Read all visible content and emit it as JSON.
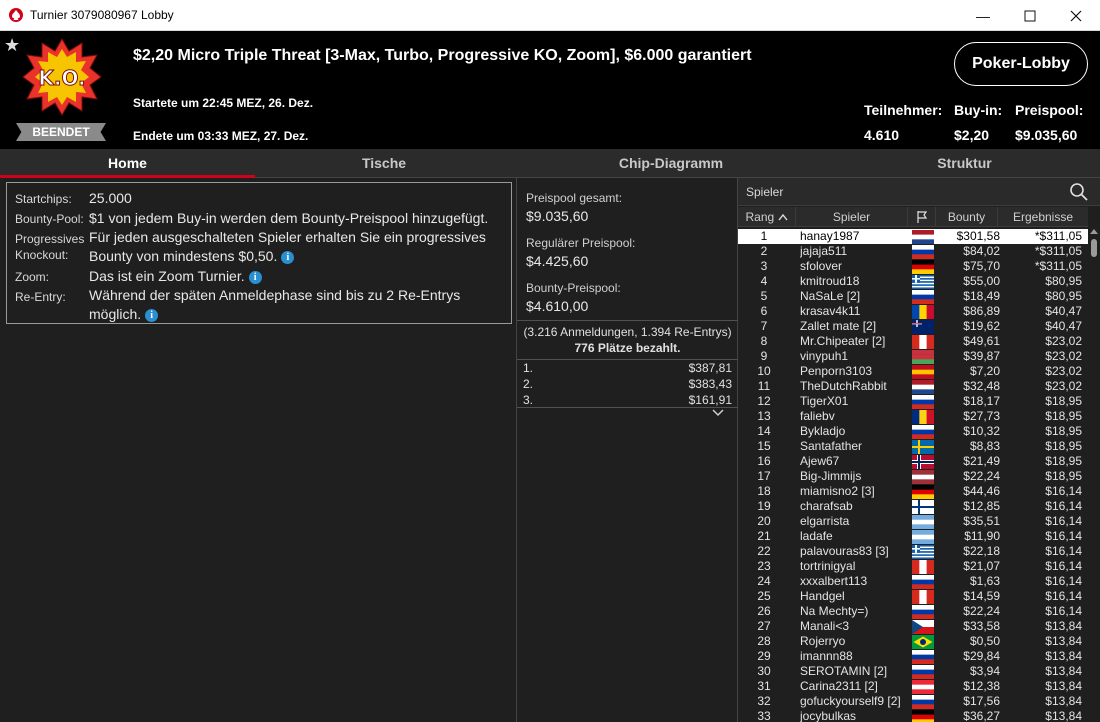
{
  "window": {
    "title": "Turnier 3079080967 Lobby"
  },
  "header": {
    "tournament_title": "$2,20 Micro Triple Threat [3-Max, Turbo, Progressive KO, Zoom], $6.000 garantiert",
    "started": "Startete um 22:45 MEZ, 26. Dez.",
    "ended": "Endete um 03:33 MEZ, 27. Dez.",
    "status": "BEENDET",
    "logo_text": "K.O.",
    "lobby_button": "Poker-Lobby",
    "stats": [
      {
        "label": "Teilnehmer:",
        "value": "4.610"
      },
      {
        "label": "Buy-in:",
        "value": "$2,20"
      },
      {
        "label": "Preispool:",
        "value": "$9.035,60"
      }
    ]
  },
  "tabs": [
    {
      "label": "Home",
      "active": true
    },
    {
      "label": "Tische",
      "active": false
    },
    {
      "label": "Chip-Diagramm",
      "active": false
    },
    {
      "label": "Struktur",
      "active": false
    }
  ],
  "home": {
    "rows": [
      {
        "label": "Startchips:",
        "value": "25.000"
      },
      {
        "label": "Bounty-Pool:",
        "value": "$1 von jedem Buy-in werden dem Bounty-Preispool hinzugefügt."
      },
      {
        "label": "Progressives",
        "label2": "Knockout:",
        "value": "Für jeden ausgeschalteten Spieler erhalten Sie ein progressives",
        "value2": "Bounty von mindestens $0,50."
      },
      {
        "label": "Zoom:",
        "value": "Das ist ein Zoom Turnier."
      },
      {
        "label": "Re-Entry:",
        "value": "Während der späten Anmeldephase sind bis zu 2 Re-Entrys",
        "value2": "möglich."
      }
    ],
    "info_glyph": "i"
  },
  "prizes": {
    "total_label": "Preispool gesamt:",
    "total_value": "$9.035,60",
    "regular_label": "Regulärer Preispool:",
    "regular_value": "$4.425,60",
    "bounty_label": "Bounty-Preispool:",
    "bounty_value": "$4.610,00",
    "registrations": "(3.216 Anmeldungen, 1.394 Re-Entrys)",
    "paid_places": "776 Plätze bezahlt.",
    "payouts": [
      {
        "place": "1.",
        "amount": "$387,81"
      },
      {
        "place": "2.",
        "amount": "$383,43"
      },
      {
        "place": "3.",
        "amount": "$161,91"
      }
    ]
  },
  "players": {
    "search_placeholder": "Spieler",
    "columns": {
      "rank": "Rang",
      "player": "Spieler",
      "bounty": "Bounty",
      "results": "Ergebnisse"
    },
    "rows": [
      {
        "rank": "1",
        "name": "hanay1987",
        "flag": "NL",
        "bounty": "$301,58",
        "result": "*$311,05",
        "selected": true
      },
      {
        "rank": "2",
        "name": "jajaja511",
        "flag": "RU",
        "bounty": "$84,02",
        "result": "*$311,05"
      },
      {
        "rank": "3",
        "name": "sfolover",
        "flag": "DE",
        "bounty": "$75,70",
        "result": "*$311,05"
      },
      {
        "rank": "4",
        "name": "kmitroud18",
        "flag": "GR",
        "bounty": "$55,00",
        "result": "$80,95"
      },
      {
        "rank": "5",
        "name": "NaSaLe [2]",
        "flag": "RU",
        "bounty": "$18,49",
        "result": "$80,95"
      },
      {
        "rank": "6",
        "name": "krasav4k11",
        "flag": "MD",
        "bounty": "$86,89",
        "result": "$40,47"
      },
      {
        "rank": "7",
        "name": "Zallet mate [2]",
        "flag": "AU",
        "bounty": "$19,62",
        "result": "$40,47"
      },
      {
        "rank": "8",
        "name": "Mr.Chipeater [2]",
        "flag": "CA",
        "bounty": "$49,61",
        "result": "$23,02"
      },
      {
        "rank": "9",
        "name": "vinypuh1",
        "flag": "BY",
        "bounty": "$39,87",
        "result": "$23,02"
      },
      {
        "rank": "10",
        "name": "Penporn3103",
        "flag": "ES",
        "bounty": "$7,20",
        "result": "$23,02"
      },
      {
        "rank": "11",
        "name": "TheDutchRabbit",
        "flag": "NL",
        "bounty": "$32,48",
        "result": "$23,02"
      },
      {
        "rank": "12",
        "name": "TigerX01",
        "flag": "RU",
        "bounty": "$18,17",
        "result": "$18,95"
      },
      {
        "rank": "13",
        "name": "faliebv",
        "flag": "RO",
        "bounty": "$27,73",
        "result": "$18,95"
      },
      {
        "rank": "14",
        "name": "Bykladjo",
        "flag": "RU",
        "bounty": "$10,32",
        "result": "$18,95"
      },
      {
        "rank": "15",
        "name": "Santafather",
        "flag": "SE",
        "bounty": "$8,83",
        "result": "$18,95"
      },
      {
        "rank": "16",
        "name": "Ajew67",
        "flag": "NO",
        "bounty": "$21,49",
        "result": "$18,95"
      },
      {
        "rank": "17",
        "name": "Big-Jimmijs",
        "flag": "LV",
        "bounty": "$22,24",
        "result": "$18,95"
      },
      {
        "rank": "18",
        "name": "miamisno2 [3]",
        "flag": "DE",
        "bounty": "$44,46",
        "result": "$16,14"
      },
      {
        "rank": "19",
        "name": "charafsab",
        "flag": "FI",
        "bounty": "$12,85",
        "result": "$16,14"
      },
      {
        "rank": "20",
        "name": "elgarrista",
        "flag": "AR",
        "bounty": "$35,51",
        "result": "$16,14"
      },
      {
        "rank": "21",
        "name": "ladafe",
        "flag": "AR",
        "bounty": "$11,90",
        "result": "$16,14"
      },
      {
        "rank": "22",
        "name": "palavouras83 [3]",
        "flag": "GR",
        "bounty": "$22,18",
        "result": "$16,14"
      },
      {
        "rank": "23",
        "name": "tortrinigyal",
        "flag": "CA",
        "bounty": "$21,07",
        "result": "$16,14"
      },
      {
        "rank": "24",
        "name": "xxxalbert113",
        "flag": "RU",
        "bounty": "$1,63",
        "result": "$16,14"
      },
      {
        "rank": "25",
        "name": "Handgel",
        "flag": "CA",
        "bounty": "$14,59",
        "result": "$16,14"
      },
      {
        "rank": "26",
        "name": "Na Mechty=)",
        "flag": "RU",
        "bounty": "$22,24",
        "result": "$16,14"
      },
      {
        "rank": "27",
        "name": "Manali<3",
        "flag": "CZ",
        "bounty": "$33,58",
        "result": "$13,84"
      },
      {
        "rank": "28",
        "name": "Rojerryo",
        "flag": "BR",
        "bounty": "$0,50",
        "result": "$13,84"
      },
      {
        "rank": "29",
        "name": "imannn88",
        "flag": "RU",
        "bounty": "$29,84",
        "result": "$13,84"
      },
      {
        "rank": "30",
        "name": "SEROTAMIN [2]",
        "flag": "RU",
        "bounty": "$3,94",
        "result": "$13,84"
      },
      {
        "rank": "31",
        "name": "Carina2311 [2]",
        "flag": "AT",
        "bounty": "$12,38",
        "result": "$13,84"
      },
      {
        "rank": "32",
        "name": "gofuckyourself9 [2]",
        "flag": "RU",
        "bounty": "$17,56",
        "result": "$13,84"
      },
      {
        "rank": "33",
        "name": "jocybulkas",
        "flag": "DE",
        "bounty": "$36,27",
        "result": "$13,84"
      }
    ]
  },
  "colors": {
    "accent": "#d0021b",
    "info": "#2a8fd0",
    "background": "#1f1f1f"
  }
}
